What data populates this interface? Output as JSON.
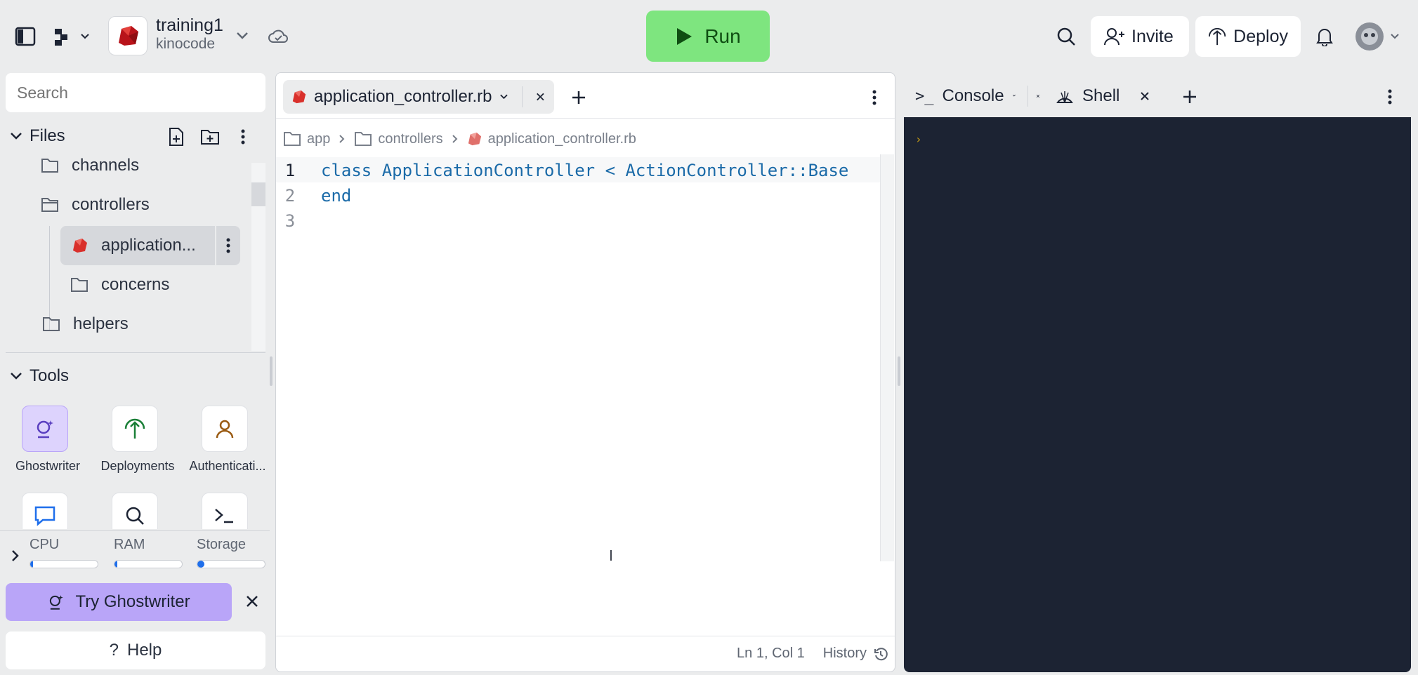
{
  "topbar": {
    "repl_name": "training1",
    "repl_owner": "kinocode",
    "run_label": "Run",
    "invite_label": "Invite",
    "deploy_label": "Deploy"
  },
  "sidebar": {
    "search_placeholder": "Search",
    "files_title": "Files",
    "tree": [
      {
        "label": "channels"
      },
      {
        "label": "controllers"
      },
      {
        "label": "application..."
      },
      {
        "label": "concerns"
      },
      {
        "label": "helpers"
      }
    ],
    "tools_title": "Tools",
    "tools": [
      {
        "label": "Ghostwriter"
      },
      {
        "label": "Deployments"
      },
      {
        "label": "Authenticati..."
      }
    ],
    "resources": [
      {
        "label": "CPU",
        "fill": 0.04
      },
      {
        "label": "RAM",
        "fill": 0.04
      },
      {
        "label": "Storage",
        "fill": 0.1
      }
    ],
    "try_ghostwriter_label": "Try Ghostwriter",
    "help_label": "Help"
  },
  "editor": {
    "tab_label": "application_controller.rb",
    "breadcrumb": [
      "app",
      "controllers",
      "application_controller.rb"
    ],
    "lines": [
      {
        "num": "1",
        "keyword": "class",
        "rest": " ApplicationController < ActionController::Base"
      },
      {
        "num": "2",
        "keyword": "end",
        "rest": ""
      },
      {
        "num": "3",
        "keyword": "",
        "rest": ""
      }
    ],
    "status_position": "Ln 1, Col 1",
    "history_label": "History"
  },
  "console_panel": {
    "tabs": [
      {
        "label": "Console"
      },
      {
        "label": "Shell"
      }
    ]
  },
  "colors": {
    "run_button": "#7ee57f",
    "console_bg": "#1c2333",
    "try_ghostwriter_bg": "#b9a5f8",
    "accent_blue": "#1f6feb"
  }
}
